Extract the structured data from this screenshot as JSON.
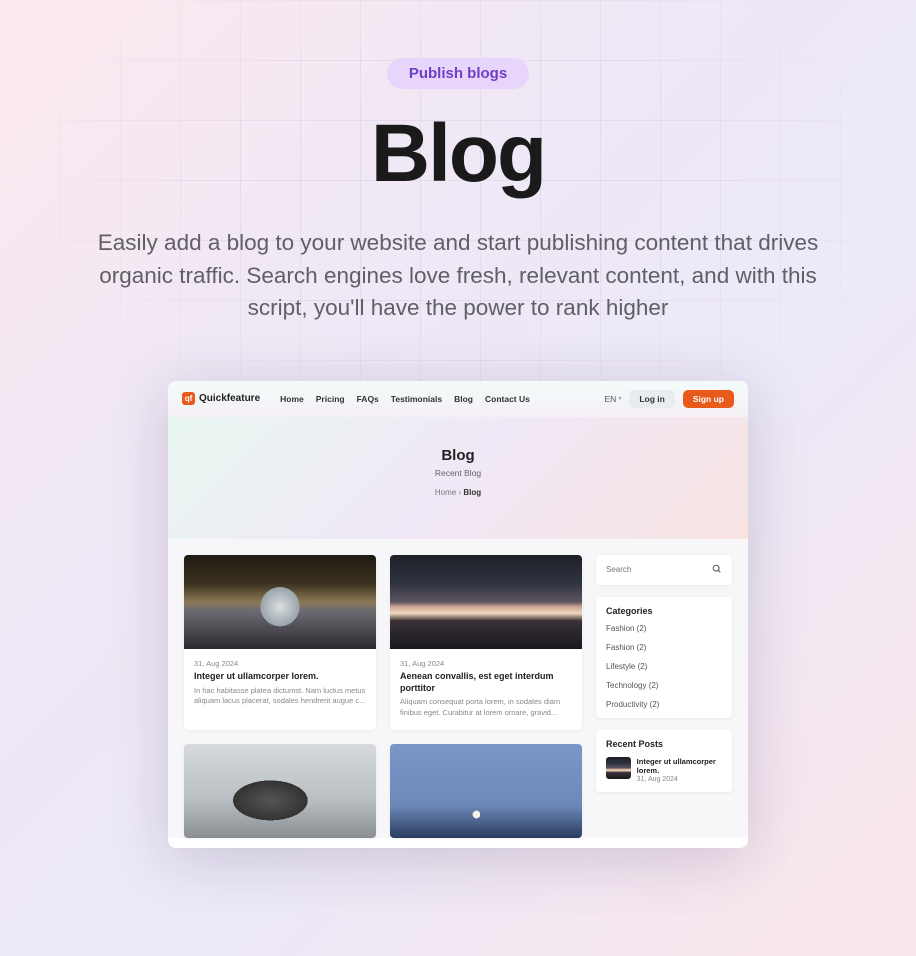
{
  "hero": {
    "badge": "Publish blogs",
    "title": "Blog",
    "subtitle": "Easily add a blog to your website and start publishing content that drives organic traffic. Search engines love fresh, relevant content, and with this script, you'll have the power to rank higher"
  },
  "screenshot": {
    "brand": "Quickfeature",
    "nav": [
      "Home",
      "Pricing",
      "FAQs",
      "Testimonials",
      "Blog",
      "Contact Us"
    ],
    "lang": "EN",
    "login": "Log in",
    "signup": "Sign up",
    "page_title": "Blog",
    "page_subtitle": "Recent Blog",
    "breadcrumb_home": "Home",
    "breadcrumb_sep": "›",
    "breadcrumb_current": "Blog",
    "search_placeholder": "Search",
    "categories_heading": "Categories",
    "categories": [
      "Fashion (2)",
      "Fashion (2)",
      "Lifestyle (2)",
      "Technology (2)",
      "Productivity (2)"
    ],
    "recent_heading": "Recent Posts",
    "recent": [
      {
        "title": "Integer ut ullamcorper lorem.",
        "date": "31, Aug 2024"
      }
    ],
    "posts": [
      {
        "date": "31, Aug 2024",
        "title": "Integer ut ullamcorper lorem.",
        "excerpt": "In hac habitasse platea dictumst. Nam luctus metus aliquam lacus placerat, sodales hendrerit augue c..."
      },
      {
        "date": "31, Aug 2024",
        "title": "Aenean convallis, est eget interdum porttitor",
        "excerpt": "Aliquam consequat porta lorem, in sodales diam finibus eget. Curabitur at lorem ornare, gravid..."
      },
      {
        "date": "",
        "title": "",
        "excerpt": ""
      },
      {
        "date": "",
        "title": "",
        "excerpt": ""
      }
    ]
  }
}
